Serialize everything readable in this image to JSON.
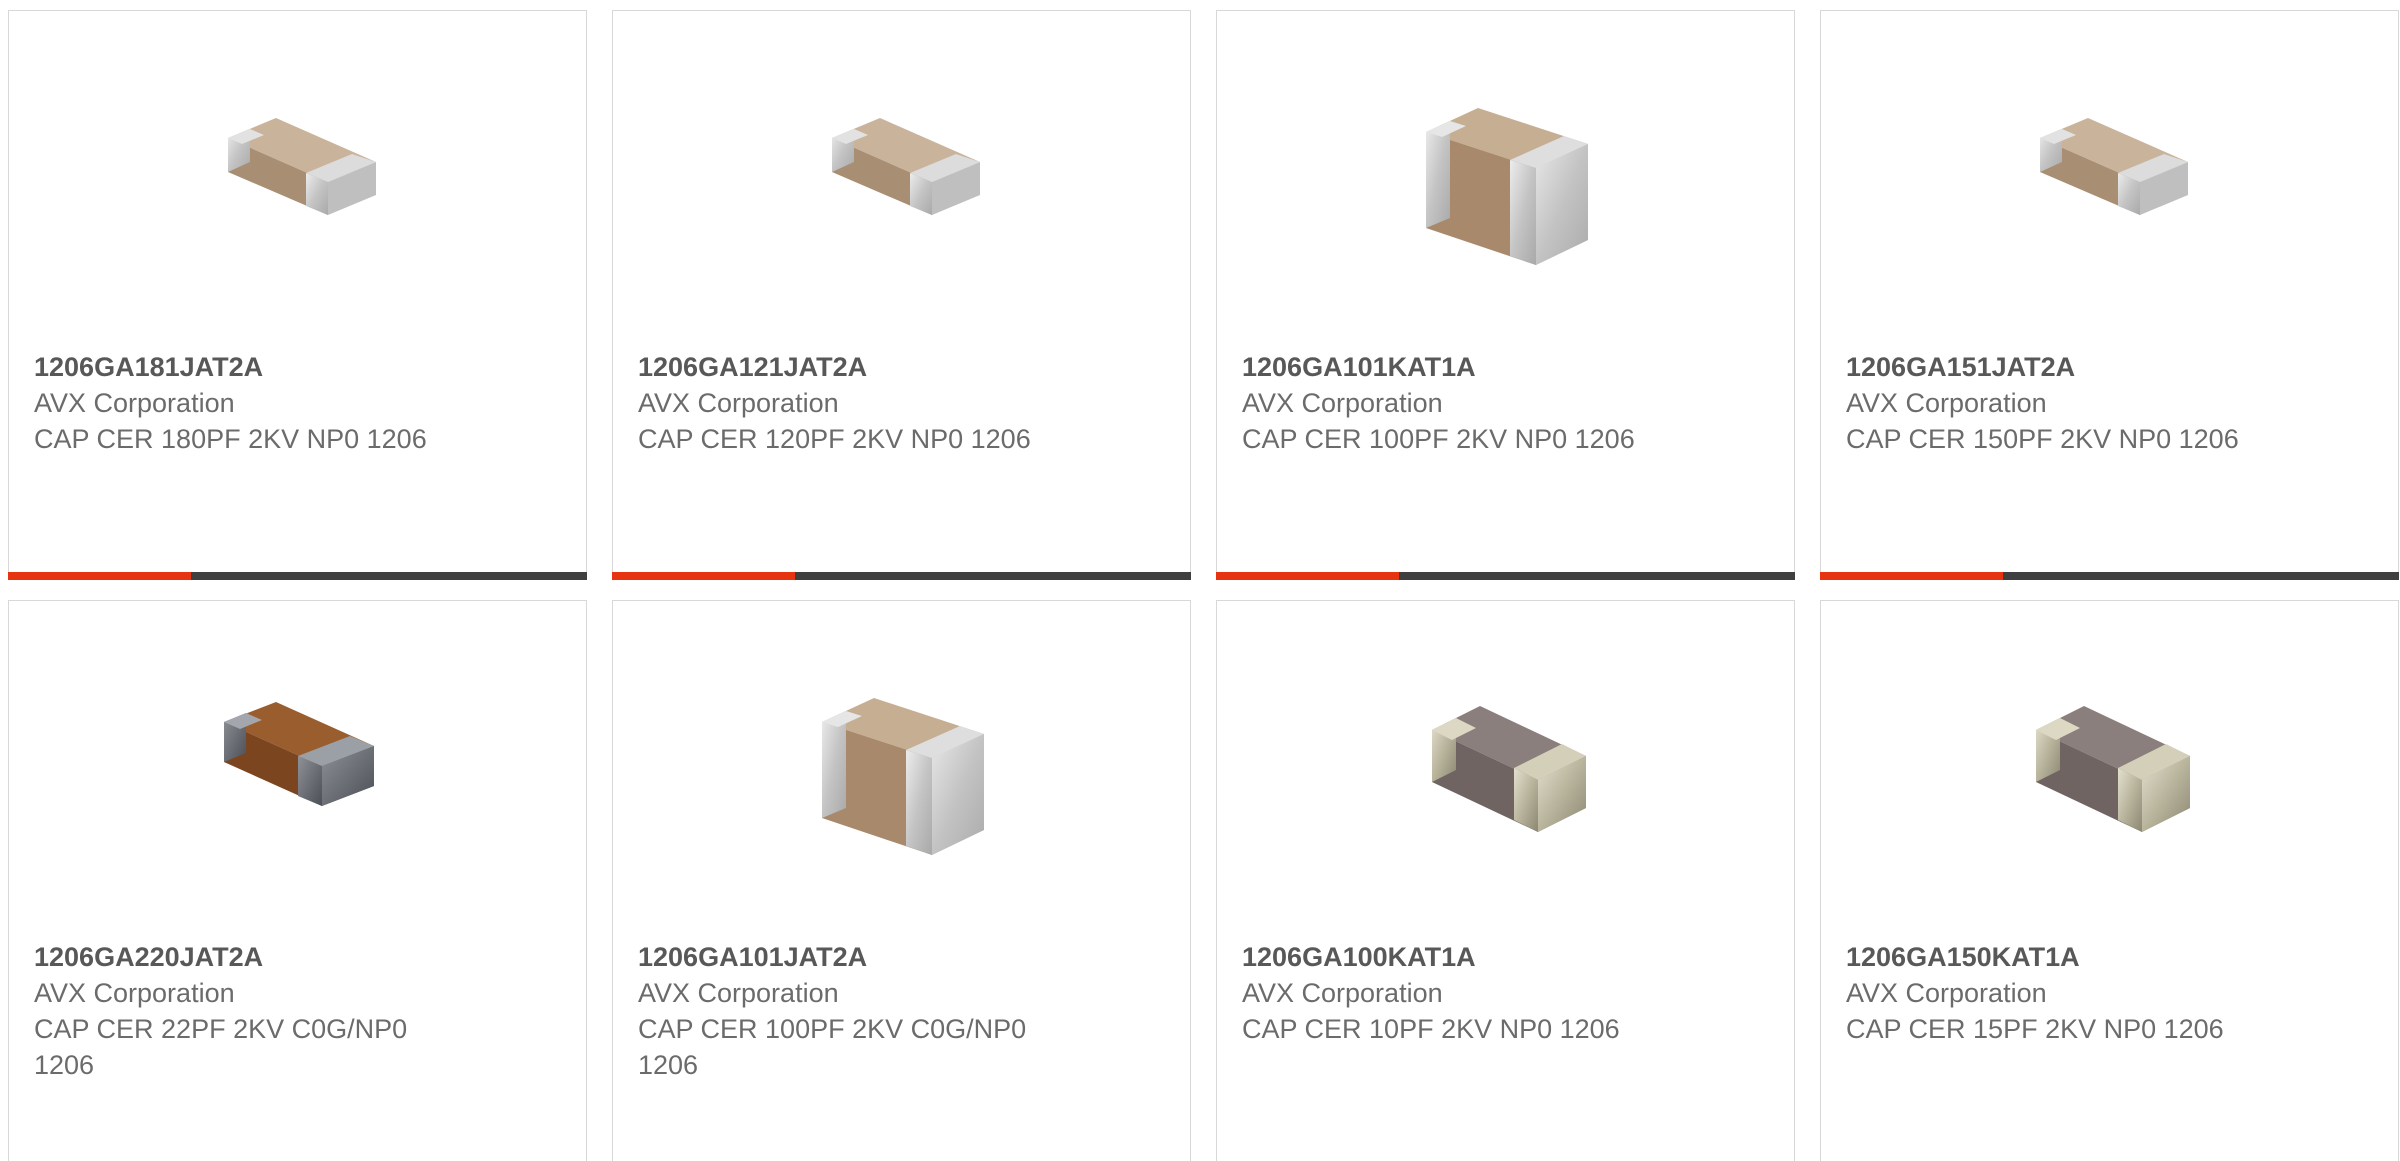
{
  "colors": {
    "accent": "#e63312",
    "bar": "#3f3f3f",
    "border": "#d8d8d8",
    "text": "#6b6b6b"
  },
  "products": [
    {
      "part_number": "1206GA181JAT2A",
      "manufacturer": "AVX Corporation",
      "description": "CAP CER 180PF 2KV NP0 1206",
      "icon": "tan-capacitor-icon"
    },
    {
      "part_number": "1206GA121JAT2A",
      "manufacturer": "AVX Corporation",
      "description": "CAP CER 120PF 2KV NP0 1206",
      "icon": "tan-capacitor-icon"
    },
    {
      "part_number": "1206GA101KAT1A",
      "manufacturer": "AVX Corporation",
      "description": "CAP CER 100PF 2KV NP0 1206",
      "icon": "tan-capacitor-large-icon"
    },
    {
      "part_number": "1206GA151JAT2A",
      "manufacturer": "AVX Corporation",
      "description": "CAP CER 150PF 2KV NP0 1206",
      "icon": "tan-capacitor-icon"
    },
    {
      "part_number": "1206GA220JAT2A",
      "manufacturer": "AVX Corporation",
      "description": "CAP CER 22PF 2KV C0G/NP0 1206",
      "icon": "brown-capacitor-icon"
    },
    {
      "part_number": "1206GA101JAT2A",
      "manufacturer": "AVX Corporation",
      "description": "CAP CER 100PF 2KV C0G/NP0 1206",
      "icon": "tan-capacitor-large-icon"
    },
    {
      "part_number": "1206GA100KAT1A",
      "manufacturer": "AVX Corporation",
      "description": "CAP CER 10PF 2KV NP0 1206",
      "icon": "gray-capacitor-icon"
    },
    {
      "part_number": "1206GA150KAT1A",
      "manufacturer": "AVX Corporation",
      "description": "CAP CER 15PF 2KV NP0 1206",
      "icon": "gray-capacitor-icon"
    }
  ]
}
